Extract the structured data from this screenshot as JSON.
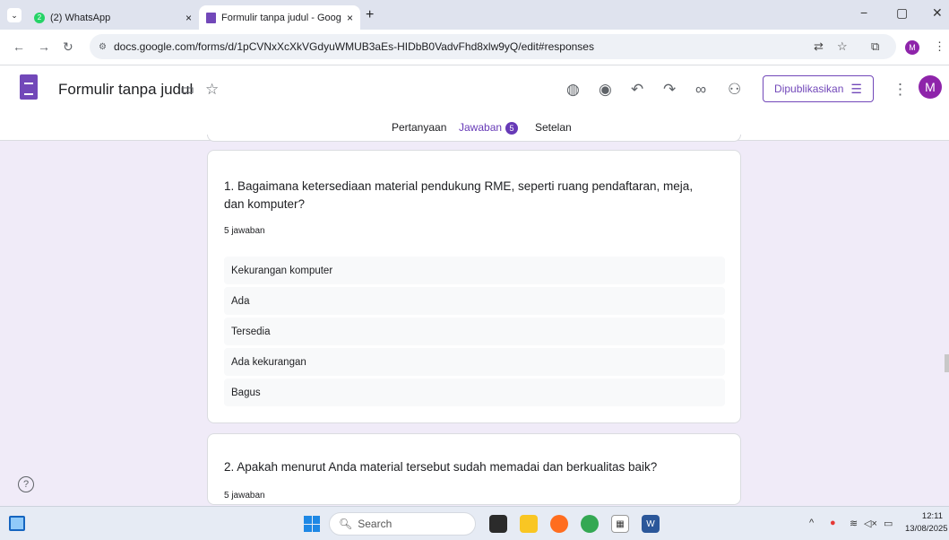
{
  "browser": {
    "tabs": [
      {
        "title": "(2) WhatsApp",
        "badge": "2",
        "close": "×",
        "active": false
      },
      {
        "title": "Formulir tanpa judul - Google F",
        "close": "×",
        "active": true
      }
    ],
    "new_tab": "+",
    "url": "docs.google.com/forms/d/1pCVNxXcXkVGdyuWMUB3aEs-HIDbB0VadvFhd8xlw9yQ/edit#responses",
    "profile_initial": "M",
    "window_controls": [
      "−",
      "▢",
      "✕"
    ]
  },
  "forms": {
    "title": "Formulir tanpa judul",
    "publish_label": "Dipublikasikan",
    "avatar_initial": "M",
    "tabs": {
      "questions": "Pertanyaan",
      "responses": "Jawaban",
      "responses_count": "5",
      "settings": "Setelan"
    }
  },
  "questions": [
    {
      "title": "1. Bagaimana ketersediaan material pendukung RME, seperti ruang pendaftaran, meja, dan komputer?",
      "count": "5 jawaban",
      "answers": [
        "Kekurangan komputer",
        "Ada",
        "Tersedia",
        "Ada kekurangan",
        "Bagus"
      ]
    },
    {
      "title": "2. Apakah menurut Anda material tersebut sudah memadai dan berkualitas baik?",
      "count": "5 jawaban"
    }
  ],
  "taskbar": {
    "search_placeholder": "Search",
    "time": "12:11",
    "date": "13/08/2025"
  },
  "colors": {
    "forms_purple": "#673ab7",
    "background": "#f0ebf8",
    "avatar": "#8e24aa"
  }
}
